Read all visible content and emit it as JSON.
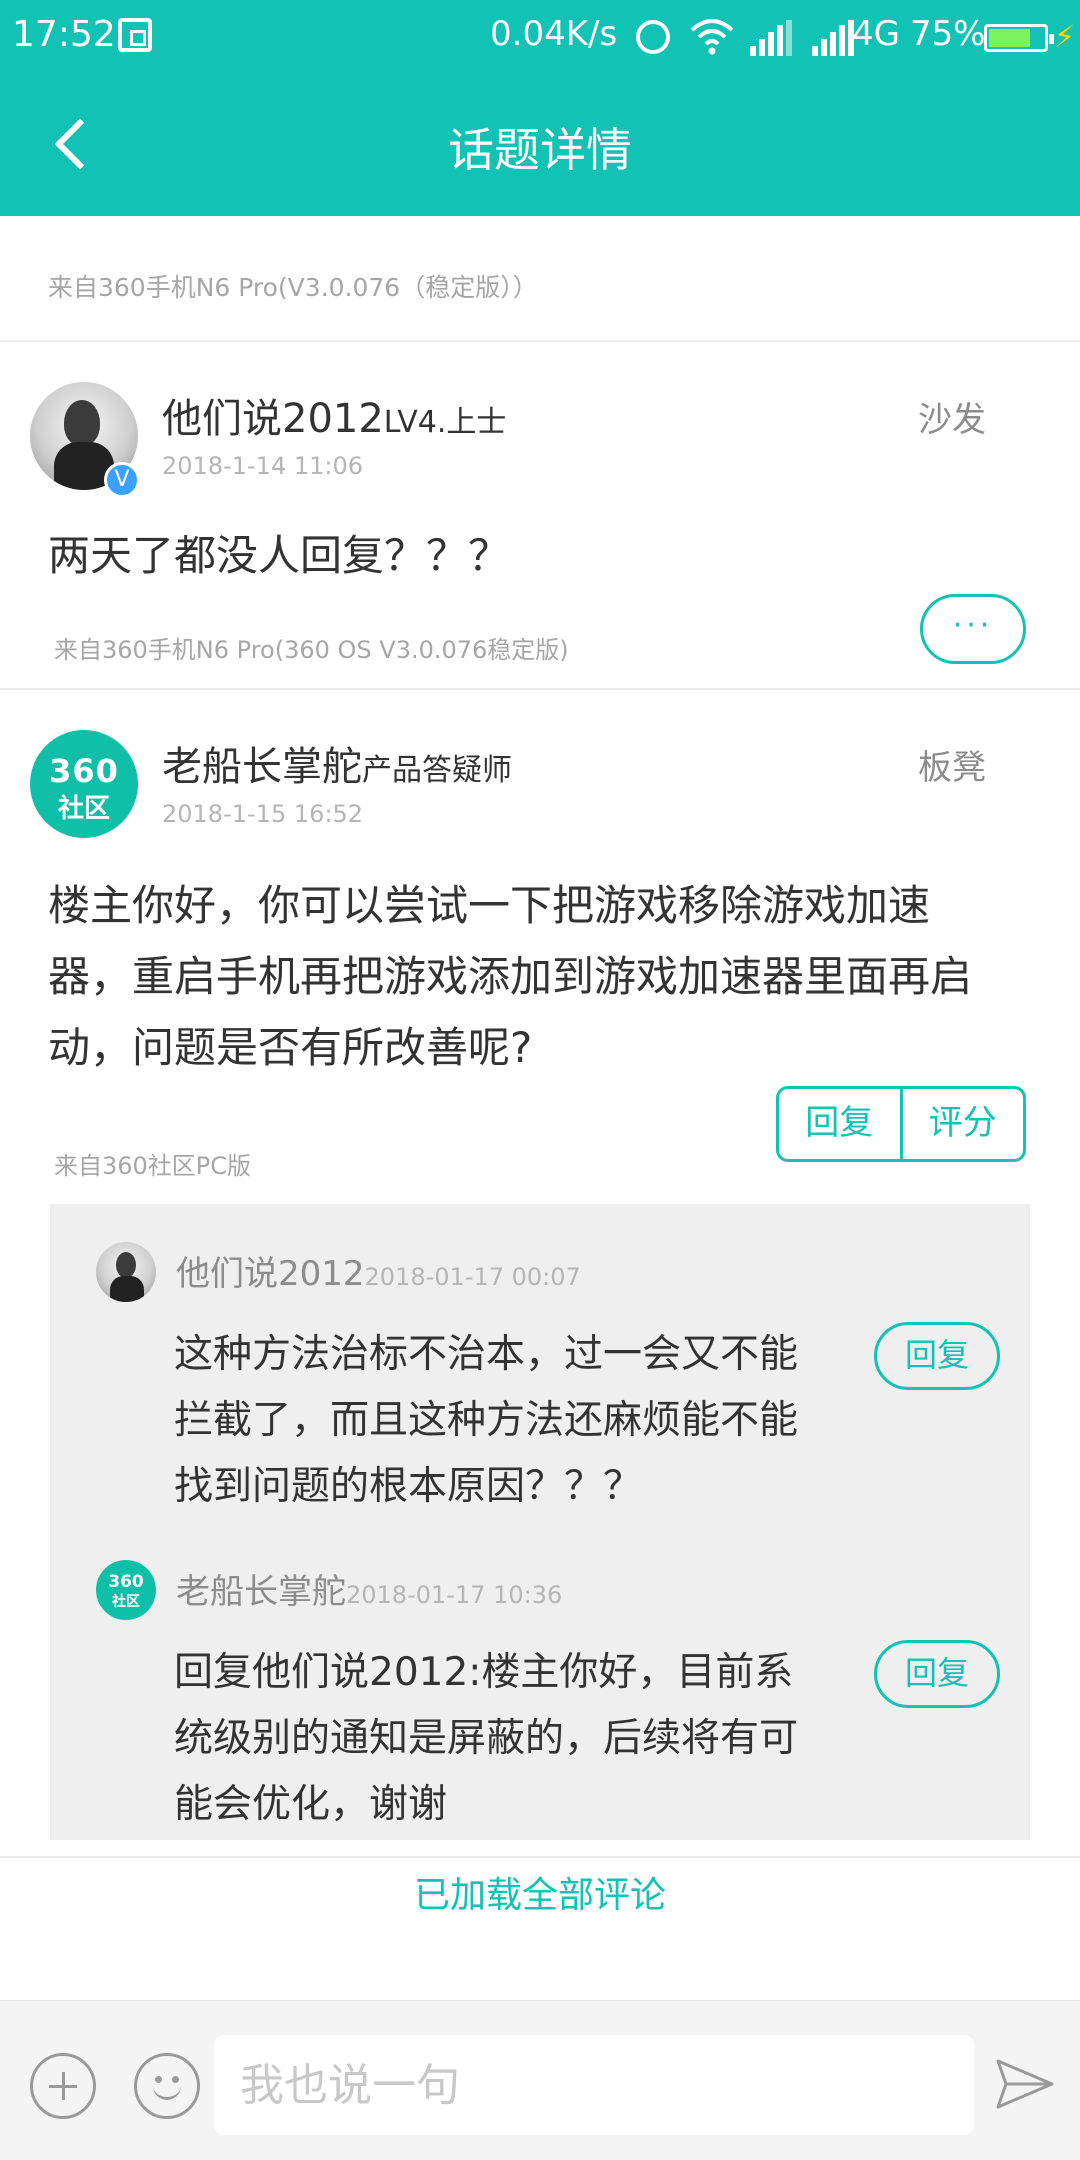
{
  "status_bar": {
    "time": "17:52",
    "speed": "0.04K/s",
    "network": "4G",
    "battery": "75%",
    "battery_level": 0.75
  },
  "header": {
    "title": "话题详情"
  },
  "topic": {
    "source": "来自360手机N6 Pro(V3.0.076（稳定版））"
  },
  "posts": [
    {
      "username": "他们说2012",
      "level": "LV4.上士",
      "date": "2018-1-14 11:06",
      "floor": "沙发",
      "content": "两天了都没人回复？？？",
      "from": "来自360手机N6 Pro(360 OS V3.0.076稳定版)",
      "more_label": "···",
      "verified_label": "V"
    },
    {
      "username": "老船长掌舵",
      "level": "产品答疑师",
      "date": "2018-1-15 16:52",
      "floor": "板凳",
      "content": "楼主你好，你可以尝试一下把游戏移除游戏加速器，重启手机再把游戏添加到游戏加速器里面再启动，问题是否有所改善呢?",
      "from": "来自360社区PC版",
      "reply_label": "回复",
      "rate_label": "评分",
      "avatar_text_1": "360",
      "avatar_text_2": "社区"
    }
  ],
  "replies": [
    {
      "username": "他们说2012",
      "date": "2018-01-17 00:07",
      "content": "这种方法治标不治本，过一会又不能拦截了，而且这种方法还麻烦能不能找到问题的根本原因？？？",
      "reply_label": "回复"
    },
    {
      "username": "老船长掌舵",
      "date": "2018-01-17 10:36",
      "content": "回复他们说2012:楼主你好，目前系统级别的通知是屏蔽的，后续将有可能会优化，谢谢",
      "reply_label": "回复",
      "avatar_text_1": "360",
      "avatar_text_2": "社区"
    }
  ],
  "footer": {
    "loaded_text": "已加载全部评论",
    "input_placeholder": "我也说一句"
  },
  "colors": {
    "accent": "#12c2b4",
    "brand_avatar": "#10bfa8",
    "reply_bg": "#efefef"
  },
  "icons": {
    "back": "chevron-left-icon",
    "add": "plus-circle-icon",
    "emoji": "smile-icon",
    "send": "send-icon"
  }
}
